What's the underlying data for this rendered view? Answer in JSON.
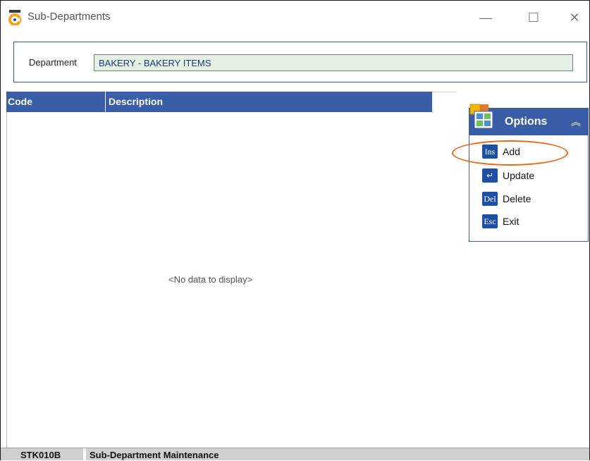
{
  "window": {
    "title": "Sub-Departments",
    "controls": {
      "minimize": "—",
      "maximize": "☐",
      "close": "✕"
    }
  },
  "department": {
    "label": "Department",
    "value": "BAKERY - BAKERY ITEMS"
  },
  "grid": {
    "columns": [
      "Code",
      "Description"
    ],
    "empty_text": "<No data to display>"
  },
  "options": {
    "title": "Options",
    "items": [
      {
        "key": "Ins",
        "label": "Add"
      },
      {
        "key": "↵",
        "label": "Update"
      },
      {
        "key": "Del",
        "label": "Delete"
      },
      {
        "key": "Esc",
        "label": "Exit"
      }
    ]
  },
  "status_bar": {
    "code": "STK010B",
    "title": "Sub-Department Maintenance"
  },
  "colors": {
    "header_blue": "#3a5da8",
    "annotation": "#e8691c",
    "field_bg": "#e6f1e6"
  }
}
